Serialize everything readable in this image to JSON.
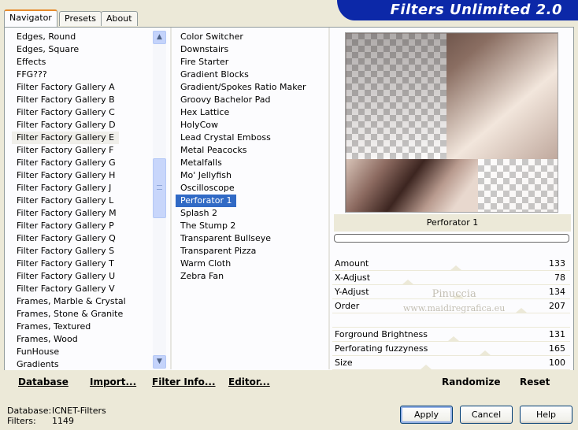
{
  "app": {
    "title": "Filters Unlimited 2.0"
  },
  "tabs": [
    "Navigator",
    "Presets",
    "About"
  ],
  "categories": [
    "Edges, Round",
    "Edges, Square",
    "Effects",
    "FFG???",
    "Filter Factory Gallery A",
    "Filter Factory Gallery B",
    "Filter Factory Gallery C",
    "Filter Factory Gallery D",
    "Filter Factory Gallery E",
    "Filter Factory Gallery F",
    "Filter Factory Gallery G",
    "Filter Factory Gallery H",
    "Filter Factory Gallery J",
    "Filter Factory Gallery L",
    "Filter Factory Gallery M",
    "Filter Factory Gallery P",
    "Filter Factory Gallery Q",
    "Filter Factory Gallery S",
    "Filter Factory Gallery T",
    "Filter Factory Gallery U",
    "Filter Factory Gallery V",
    "Frames, Marble & Crystal",
    "Frames, Stone & Granite",
    "Frames, Textured",
    "Frames, Wood",
    "FunHouse",
    "Gradients"
  ],
  "selected_category": "Filter Factory Gallery E",
  "filters": [
    "Color Switcher",
    "Downstairs",
    "Fire Starter",
    "Gradient Blocks",
    "Gradient/Spokes Ratio Maker",
    "Groovy Bachelor Pad",
    "Hex Lattice",
    "HolyCow",
    "Lead Crystal Emboss",
    "Metal Peacocks",
    "Metalfalls",
    "Mo' Jellyfish",
    "Oscilloscope",
    "Perforator 1",
    "Splash 2",
    "The Stump 2",
    "Transparent Bullseye",
    "Transparent Pizza",
    "Warm Cloth",
    "Zebra Fan"
  ],
  "selected_filter": "Perforator 1",
  "preview": {
    "caption": "Perforator 1"
  },
  "params": [
    {
      "label": "Amount",
      "value": "133",
      "level": 0.52
    },
    {
      "label": "X-Adjust",
      "value": "78",
      "level": 0.31
    },
    {
      "label": "Y-Adjust",
      "value": "134",
      "level": 0.53
    },
    {
      "label": "Order",
      "value": "207",
      "level": 0.81
    },
    {
      "label": "",
      "value": "",
      "level": null
    },
    {
      "label": "Forground Brightness",
      "value": "131",
      "level": 0.51
    },
    {
      "label": "Perforating fuzzyness",
      "value": "165",
      "level": 0.65
    },
    {
      "label": "Size",
      "value": "100",
      "level": 0.39
    }
  ],
  "watermark": {
    "line1": "Pinuccia",
    "line2": "www.maidiregrafica.eu"
  },
  "bottom_links": {
    "database": "Database",
    "import": "Import...",
    "filter_info": "Filter Info...",
    "editor": "Editor...",
    "randomize": "Randomize",
    "reset": "Reset"
  },
  "status": {
    "database_label": "Database:",
    "database_value": "ICNET-Filters",
    "filters_label": "Filters:",
    "filters_value": "1149"
  },
  "buttons": {
    "apply": "Apply",
    "cancel": "Cancel",
    "help": "Help"
  },
  "colors": {
    "banner": "#0c28a8",
    "selection": "#316ac5",
    "tab_accent": "#e68b2c"
  }
}
